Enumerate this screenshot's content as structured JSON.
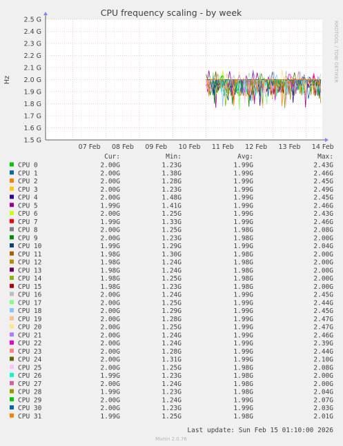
{
  "chart_data": {
    "type": "line",
    "title": "CPU frequency scaling - by week",
    "ylabel": "Hz",
    "side_label": "RRDTOOL / TOBI OETIKER",
    "ylim": [
      1.5,
      2.5
    ],
    "yticks": [
      {
        "v": 2.5,
        "label": "2.5 G"
      },
      {
        "v": 2.4,
        "label": "2.4 G"
      },
      {
        "v": 2.3,
        "label": "2.3 G"
      },
      {
        "v": 2.2,
        "label": "2.2 G"
      },
      {
        "v": 2.1,
        "label": "2.1 G"
      },
      {
        "v": 2.0,
        "label": "2.0 G"
      },
      {
        "v": 1.9,
        "label": "1.9 G"
      },
      {
        "v": 1.8,
        "label": "1.8 G"
      },
      {
        "v": 1.7,
        "label": "1.7 G"
      },
      {
        "v": 1.6,
        "label": "1.6 G"
      },
      {
        "v": 1.5,
        "label": "1.5 G"
      }
    ],
    "xticks": [
      "07 Feb",
      "08 Feb",
      "09 Feb",
      "10 Feb",
      "11 Feb",
      "12 Feb",
      "13 Feb",
      "14 Feb"
    ],
    "data_start_day": 11.0,
    "grid": true,
    "legend_headers": [
      "Cur:",
      "Min:",
      "Avg:",
      "Max:"
    ],
    "series": [
      {
        "name": "CPU 0",
        "color": "#00cc00",
        "cur": "2.00G",
        "min": "1.23G",
        "avg": "1.99G",
        "max": "2.43G"
      },
      {
        "name": "CPU 1",
        "color": "#0066b3",
        "cur": "2.00G",
        "min": "1.38G",
        "avg": "1.99G",
        "max": "2.46G"
      },
      {
        "name": "CPU 2",
        "color": "#ff8000",
        "cur": "2.00G",
        "min": "1.28G",
        "avg": "1.99G",
        "max": "2.45G"
      },
      {
        "name": "CPU 3",
        "color": "#ffcc00",
        "cur": "2.00G",
        "min": "1.23G",
        "avg": "1.99G",
        "max": "2.49G"
      },
      {
        "name": "CPU 4",
        "color": "#330099",
        "cur": "2.00G",
        "min": "1.48G",
        "avg": "1.99G",
        "max": "2.45G"
      },
      {
        "name": "CPU 5",
        "color": "#990099",
        "cur": "1.99G",
        "min": "1.41G",
        "avg": "1.99G",
        "max": "2.46G"
      },
      {
        "name": "CPU 6",
        "color": "#ccff00",
        "cur": "2.00G",
        "min": "1.25G",
        "avg": "1.99G",
        "max": "2.43G"
      },
      {
        "name": "CPU 7",
        "color": "#ff0000",
        "cur": "1.99G",
        "min": "1.33G",
        "avg": "1.99G",
        "max": "2.46G"
      },
      {
        "name": "CPU 8",
        "color": "#808080",
        "cur": "2.00G",
        "min": "1.25G",
        "avg": "1.98G",
        "max": "2.08G"
      },
      {
        "name": "CPU 9",
        "color": "#008f00",
        "cur": "2.00G",
        "min": "1.23G",
        "avg": "1.98G",
        "max": "2.00G"
      },
      {
        "name": "CPU 10",
        "color": "#00487d",
        "cur": "1.99G",
        "min": "1.29G",
        "avg": "1.99G",
        "max": "2.04G"
      },
      {
        "name": "CPU 11",
        "color": "#b35a00",
        "cur": "1.98G",
        "min": "1.30G",
        "avg": "1.98G",
        "max": "2.00G"
      },
      {
        "name": "CPU 12",
        "color": "#b38f00",
        "cur": "1.98G",
        "min": "1.24G",
        "avg": "1.98G",
        "max": "2.00G"
      },
      {
        "name": "CPU 13",
        "color": "#6b006b",
        "cur": "1.98G",
        "min": "1.24G",
        "avg": "1.98G",
        "max": "2.00G"
      },
      {
        "name": "CPU 14",
        "color": "#8fb300",
        "cur": "1.98G",
        "min": "1.25G",
        "avg": "1.98G",
        "max": "2.00G"
      },
      {
        "name": "CPU 15",
        "color": "#b30000",
        "cur": "1.98G",
        "min": "1.23G",
        "avg": "1.98G",
        "max": "2.00G"
      },
      {
        "name": "CPU 16",
        "color": "#bebebe",
        "cur": "2.00G",
        "min": "1.24G",
        "avg": "1.99G",
        "max": "2.45G"
      },
      {
        "name": "CPU 17",
        "color": "#80ff80",
        "cur": "2.00G",
        "min": "1.25G",
        "avg": "1.99G",
        "max": "2.44G"
      },
      {
        "name": "CPU 18",
        "color": "#80c9ff",
        "cur": "2.00G",
        "min": "1.29G",
        "avg": "1.99G",
        "max": "2.45G"
      },
      {
        "name": "CPU 19",
        "color": "#ffc080",
        "cur": "2.00G",
        "min": "1.28G",
        "avg": "1.99G",
        "max": "2.47G"
      },
      {
        "name": "CPU 20",
        "color": "#ffe680",
        "cur": "2.00G",
        "min": "1.25G",
        "avg": "1.99G",
        "max": "2.47G"
      },
      {
        "name": "CPU 21",
        "color": "#aa80ff",
        "cur": "2.00G",
        "min": "1.24G",
        "avg": "1.99G",
        "max": "2.46G"
      },
      {
        "name": "CPU 22",
        "color": "#ee00cc",
        "cur": "2.00G",
        "min": "1.24G",
        "avg": "1.99G",
        "max": "2.39G"
      },
      {
        "name": "CPU 23",
        "color": "#ff8080",
        "cur": "2.00G",
        "min": "1.28G",
        "avg": "1.99G",
        "max": "2.44G"
      },
      {
        "name": "CPU 24",
        "color": "#666600",
        "cur": "2.00G",
        "min": "1.31G",
        "avg": "1.99G",
        "max": "2.10G"
      },
      {
        "name": "CPU 25",
        "color": "#ffbfff",
        "cur": "2.00G",
        "min": "1.25G",
        "avg": "1.98G",
        "max": "2.08G"
      },
      {
        "name": "CPU 26",
        "color": "#00ffcc",
        "cur": "1.99G",
        "min": "1.23G",
        "avg": "1.98G",
        "max": "2.00G"
      },
      {
        "name": "CPU 27",
        "color": "#cc6699",
        "cur": "2.00G",
        "min": "1.24G",
        "avg": "1.98G",
        "max": "2.00G"
      },
      {
        "name": "CPU 28",
        "color": "#999900",
        "cur": "1.99G",
        "min": "1.23G",
        "avg": "1.98G",
        "max": "2.04G"
      },
      {
        "name": "CPU 29",
        "color": "#00cc00",
        "cur": "2.00G",
        "min": "1.24G",
        "avg": "1.99G",
        "max": "2.07G"
      },
      {
        "name": "CPU 30",
        "color": "#0066b3",
        "cur": "2.00G",
        "min": "1.23G",
        "avg": "1.99G",
        "max": "2.03G"
      },
      {
        "name": "CPU 31",
        "color": "#ff8000",
        "cur": "1.99G",
        "min": "1.25G",
        "avg": "1.98G",
        "max": "2.01G"
      }
    ],
    "last_update": "Last update: Sun Feb 15 01:10:00 2026",
    "footer": "Munin 2.0.76"
  }
}
